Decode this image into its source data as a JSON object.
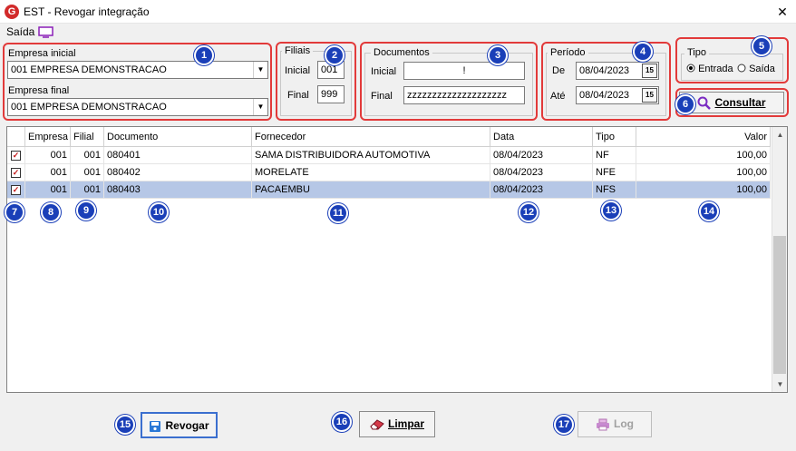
{
  "window": {
    "title": "EST - Revogar integração",
    "close": "✕",
    "icon_letter": "G"
  },
  "menu": {
    "saida": "Saída"
  },
  "empresa": {
    "inicial_label": "Empresa inicial",
    "inicial_value": "001 EMPRESA DEMONSTRACAO",
    "final_label": "Empresa final",
    "final_value": "001 EMPRESA DEMONSTRACAO"
  },
  "filiais": {
    "title": "Filiais",
    "inicial_label": "Inicial",
    "inicial_value": "001",
    "final_label": "Final",
    "final_value": "999"
  },
  "documentos": {
    "title": "Documentos",
    "inicial_label": "Inicial",
    "inicial_value": "!",
    "final_label": "Final",
    "final_value": "zzzzzzzzzzzzzzzzzzzz"
  },
  "periodo": {
    "title": "Período",
    "de_label": "De",
    "de_value": "08/04/2023",
    "ate_label": "Até",
    "ate_value": "08/04/2023",
    "cal": "15"
  },
  "tipo": {
    "title": "Tipo",
    "entrada": "Entrada",
    "saida": "Saída",
    "selected": "Entrada"
  },
  "consultar": {
    "label": "Consultar"
  },
  "grid": {
    "columns": [
      "",
      "Empresa",
      "Filial",
      "Documento",
      "Fornecedor",
      "Data",
      "Tipo",
      "Valor"
    ],
    "rows": [
      {
        "checked": true,
        "empresa": "001",
        "filial": "001",
        "documento": "080401",
        "fornecedor": "SAMA DISTRIBUIDORA AUTOMOTIVA",
        "data": "08/04/2023",
        "tipo": "NF",
        "valor": "100,00"
      },
      {
        "checked": true,
        "empresa": "001",
        "filial": "001",
        "documento": "080402",
        "fornecedor": "MORELATE",
        "data": "08/04/2023",
        "tipo": "NFE",
        "valor": "100,00"
      },
      {
        "checked": true,
        "empresa": "001",
        "filial": "001",
        "documento": "080403",
        "fornecedor": "PACAEMBU",
        "data": "08/04/2023",
        "tipo": "NFS",
        "valor": "100,00"
      }
    ]
  },
  "buttons": {
    "revogar": "Revogar",
    "limpar": "Limpar",
    "log": "Log"
  },
  "badges": [
    "1",
    "2",
    "3",
    "4",
    "5",
    "6",
    "7",
    "8",
    "9",
    "10",
    "11",
    "12",
    "13",
    "14",
    "15",
    "16",
    "17"
  ],
  "colors": {
    "badge": "#1a3fb8",
    "highlight": "#e23a3a",
    "selection": "#b6c7e6"
  }
}
